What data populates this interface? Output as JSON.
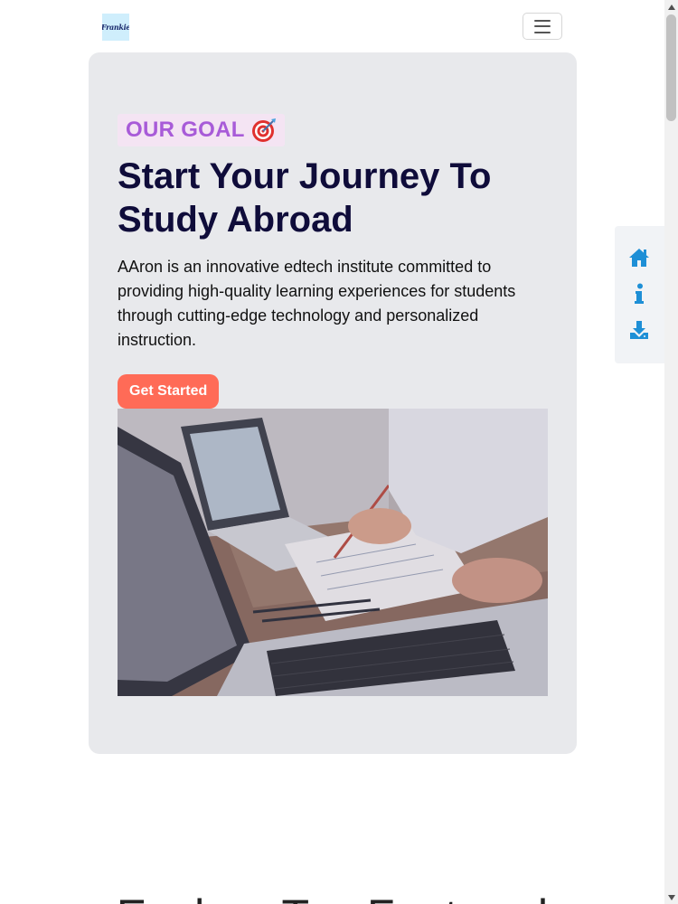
{
  "navbar": {
    "logo_text": "Frankie",
    "toggler_label": "Toggle navigation"
  },
  "hero": {
    "badge_text": "OUR GOAL",
    "badge_icon": "target-emoji",
    "title": "Start Your Journey To Study Abroad",
    "description": "AAron is an innovative edtech institute committed to providing high-quality learning experiences for students through cutting-edge technology and personalized instruction.",
    "cta_label": "Get Started",
    "image_alt": "Students working on laptops with notes"
  },
  "side_nav": {
    "items": [
      {
        "icon": "home-icon",
        "label": "Home"
      },
      {
        "icon": "info-icon",
        "label": "Info"
      },
      {
        "icon": "download-icon",
        "label": "Download"
      }
    ],
    "accent_color": "#1e8fd6"
  },
  "next_section": {
    "heading": "Explore Top Featured"
  },
  "colors": {
    "hero_bg": "#e8e9ec",
    "badge_bg": "#f4e4f3",
    "badge_text": "#a85bd8",
    "title": "#0f0c3a",
    "cta_bg": "#ff6b57"
  }
}
